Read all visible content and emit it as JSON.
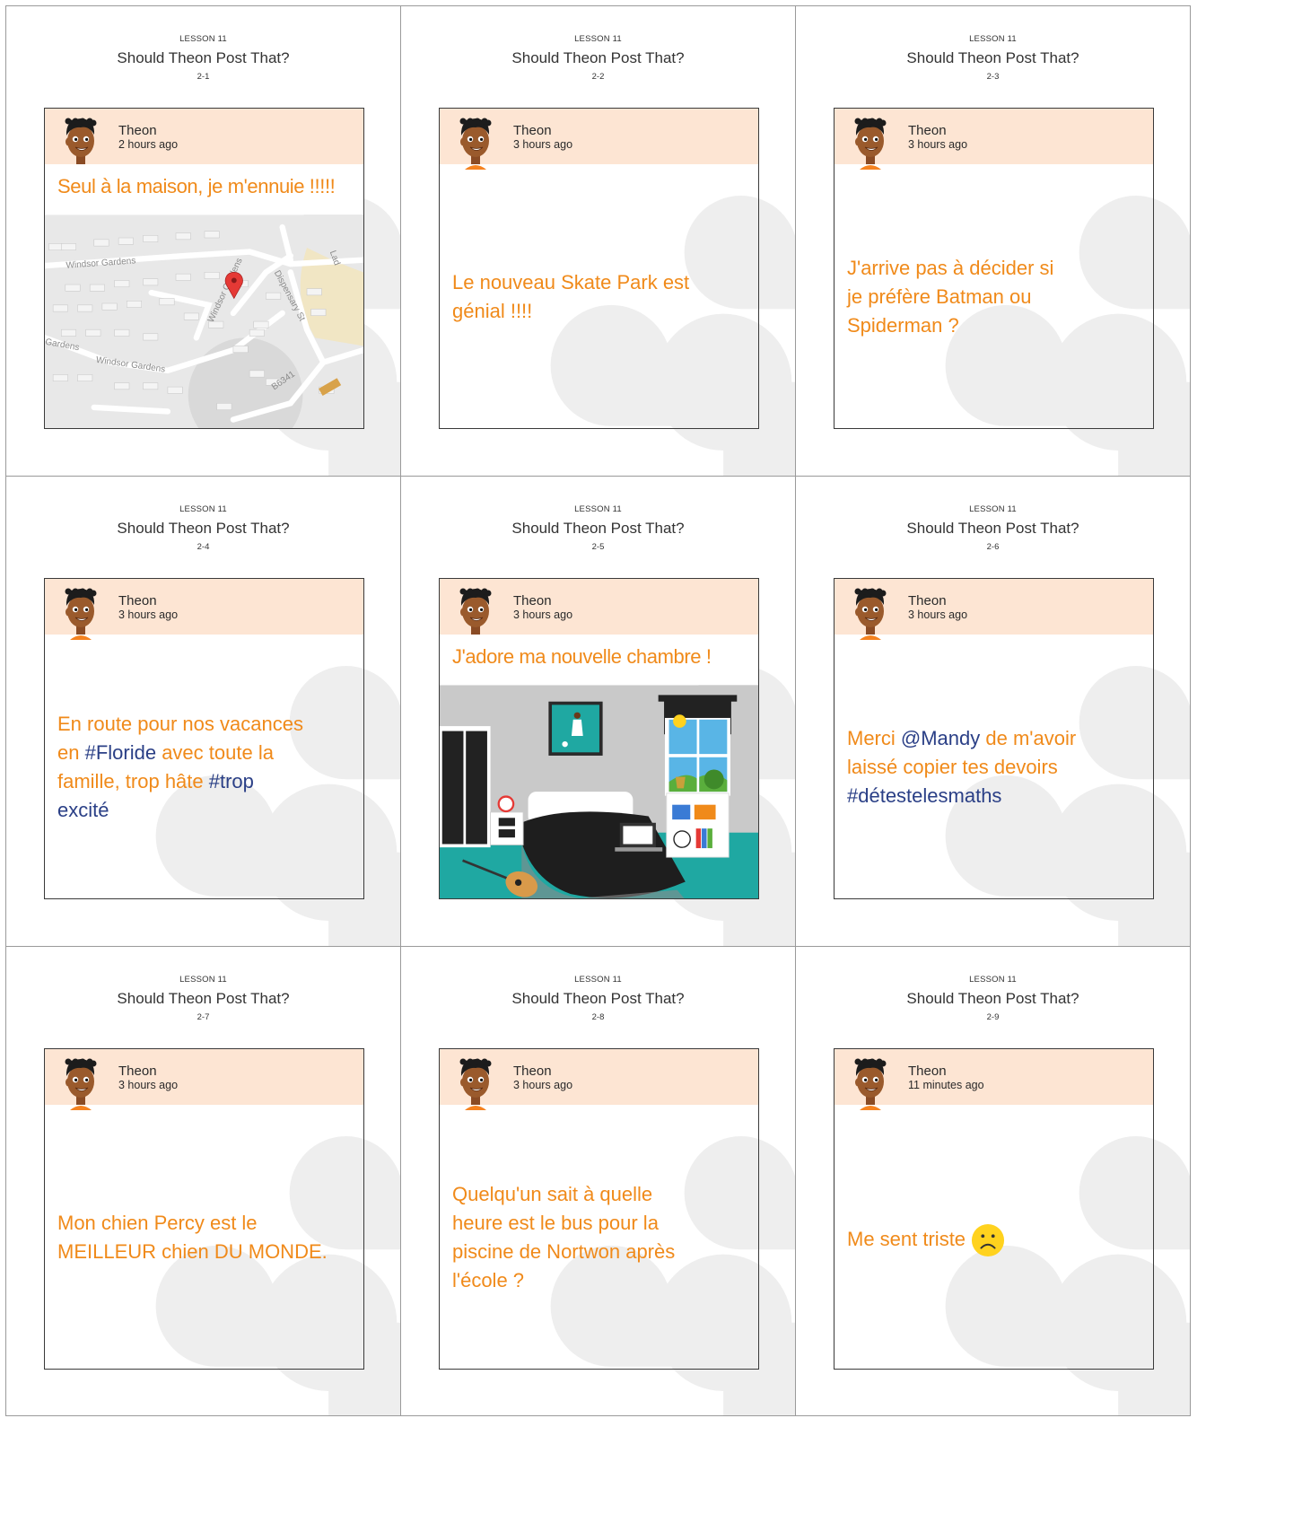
{
  "lesson_label": "LESSON 11",
  "worksheet_title": "Should Theon Post That?",
  "cards": [
    {
      "number": "2-1",
      "author": "Theon",
      "time": "2 hours ago",
      "text": "Seul à la maison, je m'ennuie !!!!!",
      "media": "map",
      "map_labels": [
        "Windsor Gardens",
        "Windsor Gardens",
        "Windsor Gardens",
        "Gardens",
        "Dispensary St",
        "B6341",
        "Lad"
      ],
      "media_icon": "map-pin-icon"
    },
    {
      "number": "2-2",
      "author": "Theon",
      "time": "3 hours ago",
      "text_parts": [
        {
          "t": "Le nouveau Skate Park est",
          "tag": false
        },
        {
          "t": "génial !!!!",
          "tag": false
        }
      ]
    },
    {
      "number": "2-3",
      "author": "Theon",
      "time": "3 hours ago",
      "text_parts": [
        {
          "t": "J'arrive pas à décider si",
          "tag": false
        },
        {
          "t": "je préfère Batman ou",
          "tag": false
        },
        {
          "t": "Spiderman ?",
          "tag": false
        }
      ]
    },
    {
      "number": "2-4",
      "author": "Theon",
      "time": "3 hours ago",
      "lines": [
        [
          {
            "t": "En route pour nos vacances",
            "tag": false
          }
        ],
        [
          {
            "t": "en ",
            "tag": false
          },
          {
            "t": "#Floride",
            "tag": true
          },
          {
            "t": " avec toute la",
            "tag": false
          }
        ],
        [
          {
            "t": "famille, trop hâte ",
            "tag": false
          },
          {
            "t": "#trop",
            "tag": true
          }
        ],
        [
          {
            "t": "excité",
            "tag": true
          }
        ]
      ]
    },
    {
      "number": "2-5",
      "author": "Theon",
      "time": "3 hours ago",
      "text": "J'adore ma nouvelle chambre !",
      "media": "bedroom",
      "media_icon": "bedroom-illustration"
    },
    {
      "number": "2-6",
      "author": "Theon",
      "time": "3 hours ago",
      "lines": [
        [
          {
            "t": "Merci ",
            "tag": false
          },
          {
            "t": "@Mandy",
            "tag": true
          },
          {
            "t": " de m'avoir",
            "tag": false
          }
        ],
        [
          {
            "t": "laissé copier tes devoirs",
            "tag": false
          }
        ],
        [
          {
            "t": "#détestelesmaths",
            "tag": true
          }
        ]
      ]
    },
    {
      "number": "2-7",
      "author": "Theon",
      "time": "3 hours ago",
      "text_parts": [
        {
          "t": "Mon chien Percy est le",
          "tag": false
        },
        {
          "t": "MEILLEUR chien DU MONDE.",
          "tag": false
        }
      ]
    },
    {
      "number": "2-8",
      "author": "Theon",
      "time": "3 hours ago",
      "text_parts": [
        {
          "t": "Quelqu'un sait à quelle",
          "tag": false
        },
        {
          "t": "heure est le bus pour la",
          "tag": false
        },
        {
          "t": "piscine de Nortwon après",
          "tag": false
        },
        {
          "t": "l'école ?",
          "tag": false
        }
      ]
    },
    {
      "number": "2-9",
      "author": "Theon",
      "time": "11 minutes ago",
      "text_parts": [
        {
          "t": "Me sent triste",
          "tag": false
        }
      ],
      "emoji": "sad-face-icon"
    }
  ],
  "colors": {
    "post_text": "#f08a1a",
    "hashtag": "#2a3f86",
    "card_header_bg": "#fde5d3",
    "border": "#9a9a9a",
    "emoji_fill": "#ffd21e"
  }
}
